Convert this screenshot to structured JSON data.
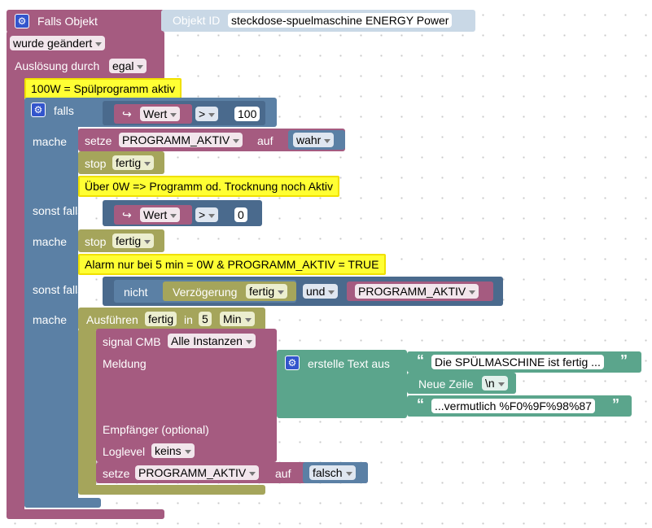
{
  "trigger": {
    "label": "Falls Objekt",
    "object_id_label": "Objekt ID",
    "object_id_value": "steckdose-spuelmaschine ENERGY  Power",
    "changed": "wurde geändert",
    "trigger_by_label": "Auslösung durch",
    "trigger_by_value": "egal"
  },
  "comments": {
    "c1": "100W = Spülprogramm aktiv",
    "c2": "Über 0W => Programm od. Trocknung noch Aktiv",
    "c3": "Alarm nur bei 5 min = 0W & PROGRAMM_AKTIV = TRUE"
  },
  "if_block": {
    "falls": "falls",
    "mache": "mache",
    "sonst_falls": "sonst falls",
    "cond1": {
      "var": "Wert",
      "op": ">",
      "value": "100"
    },
    "then1": {
      "setze": "setze",
      "var": "PROGRAMM_AKTIV",
      "auf": "auf",
      "value": "wahr",
      "stop": "stop",
      "stop_value": "fertig"
    },
    "cond2": {
      "var": "Wert",
      "op": ">",
      "value": "0"
    },
    "then2": {
      "stop": "stop",
      "stop_value": "fertig"
    },
    "cond3": {
      "nicht": "nicht",
      "delay_label": "Verzögerung",
      "delay_value": "fertig",
      "und": "und",
      "var": "PROGRAMM_AKTIV"
    },
    "then3": {
      "ausfuehren": "Ausführen",
      "ausfuehren_value": "fertig",
      "in": "in",
      "amount": "5",
      "unit": "Min",
      "signal_label": "signal CMB",
      "signal_value": "Alle Instanzen",
      "meldung": "Meldung",
      "text_block": "erstelle Text aus",
      "text1": "Die SPÜLMASCHINE ist fertig ...",
      "newline_label": "Neue Zeile",
      "newline_value": "\\n",
      "text2": "...vermutlich %F0%9F%98%87",
      "empfaenger": "Empfänger (optional)",
      "loglevel_label": "Loglevel",
      "loglevel_value": "keins",
      "setze": "setze",
      "var": "PROGRAMM_AKTIV",
      "auf": "auf",
      "value": "falsch"
    }
  },
  "colors": {
    "event": "#a55b80",
    "control": "#5b80a5",
    "timer": "#a5a55b",
    "text": "#5ba58c",
    "comment": "#ffff33"
  }
}
